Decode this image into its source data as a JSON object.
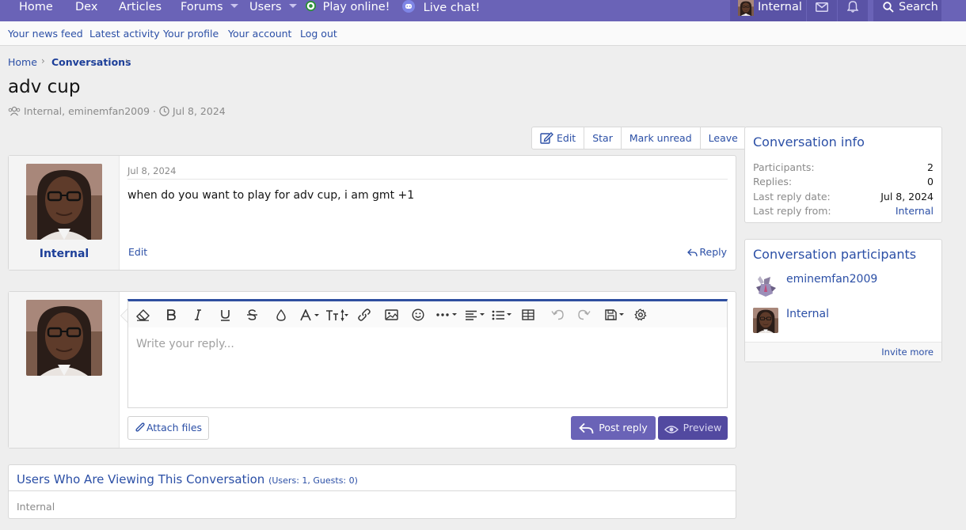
{
  "topnav": {
    "items": [
      "Home",
      "Dex",
      "Articles",
      "Forums",
      "Users",
      "Play online!",
      "Live chat!"
    ],
    "user": "Internal",
    "search": "Search"
  },
  "subnav": [
    "Your news feed",
    "Latest activity",
    "Your profile",
    "Your account",
    "Log out"
  ],
  "breadcrumb": [
    "Home",
    "Conversations"
  ],
  "title": "adv cup",
  "meta": {
    "participants": "Internal, eminemfan2009",
    "separator": "·",
    "date": "Jul 8, 2024"
  },
  "actions": [
    "Edit",
    "Star",
    "Mark unread",
    "Leave"
  ],
  "message": {
    "author": "Internal",
    "date": "Jul 8, 2024",
    "body": "when do you want to play for adv cup, i am gmt +1",
    "edit": "Edit",
    "reply": "Reply"
  },
  "editor": {
    "placeholder": "Write your reply...",
    "attach": "Attach files",
    "post": "Post reply",
    "preview": "Preview"
  },
  "viewers": {
    "title": "Users Who Are Viewing This Conversation",
    "counts": "(Users: 1, Guests: 0)",
    "list": "Internal"
  },
  "info": {
    "title": "Conversation info",
    "rows": [
      {
        "label": "Participants:",
        "value": "2"
      },
      {
        "label": "Replies:",
        "value": "0"
      },
      {
        "label": "Last reply date:",
        "value": "Jul 8, 2024"
      },
      {
        "label": "Last reply from:",
        "value": "Internal"
      }
    ]
  },
  "participants": {
    "title": "Conversation participants",
    "list": [
      "eminemfan2009",
      "Internal"
    ],
    "invite": "Invite more"
  },
  "colors": {
    "nav": "#6a63b7",
    "accent": "#2b4fa6",
    "link_dark": "#1d3f99",
    "button": "#6a63b7"
  }
}
